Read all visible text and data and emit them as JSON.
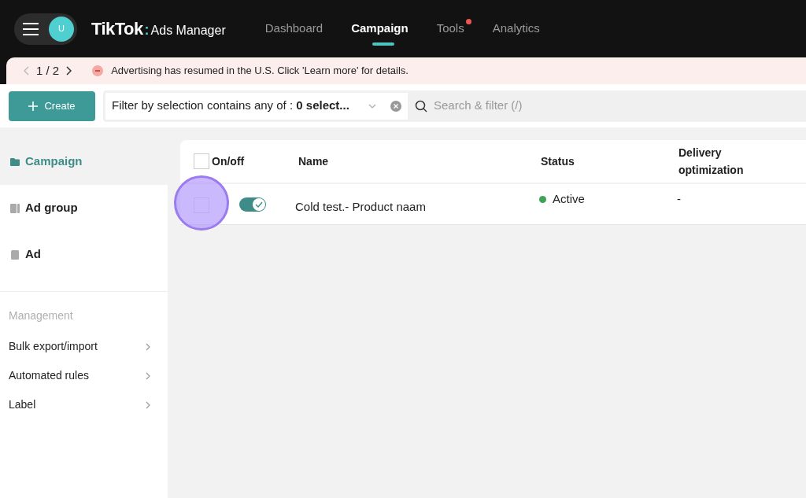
{
  "header": {
    "avatar_initial": "U",
    "logo": "TikTok",
    "logo_separator": ":",
    "logo_suffix": "Ads Manager",
    "nav": [
      {
        "label": "Dashboard",
        "selected": false,
        "notification": false
      },
      {
        "label": "Campaign",
        "selected": true,
        "notification": false
      },
      {
        "label": "Tools",
        "selected": false,
        "notification": true
      },
      {
        "label": "Analytics",
        "selected": false,
        "notification": false
      }
    ]
  },
  "banner": {
    "pager": "1 / 2",
    "message": "Advertising has resumed in the U.S. Click 'Learn more' for details."
  },
  "toolbar": {
    "create": "Create",
    "filter": "Filter by selection contains any of : **0 select...**",
    "search": {
      "placeholder": "Search & filter (/)"
    }
  },
  "sidebar": {
    "items": [
      {
        "label": "Campaign",
        "selected": true
      },
      {
        "label": "Ad group",
        "selected": false
      },
      {
        "label": "Ad",
        "selected": false
      }
    ],
    "section": "Management",
    "links": [
      "Bulk export/import",
      "Automated rules",
      "Label"
    ]
  },
  "table": {
    "columns": [
      "On/off",
      "Name",
      "Status",
      "Delivery optimization"
    ],
    "header_checked": false,
    "rows": [
      {
        "checked": false,
        "on": true,
        "name": "Cold test.- Product naam",
        "status": "Active",
        "color": "#3fa355",
        "delivery": "-"
      }
    ]
  }
}
